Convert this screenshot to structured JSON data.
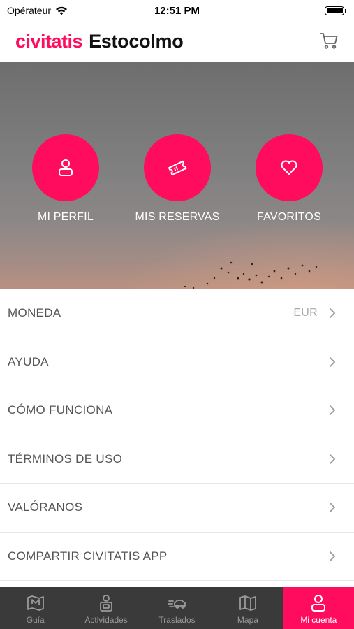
{
  "status": {
    "carrier": "Opérateur",
    "time": "12:51 PM"
  },
  "header": {
    "brand": "civitatis",
    "city": "Estocolmo"
  },
  "hero": {
    "buttons": [
      {
        "label": "MI PERFIL",
        "icon": "user-icon"
      },
      {
        "label": "MIS RESERVAS",
        "icon": "ticket-icon"
      },
      {
        "label": "FAVORITOS",
        "icon": "heart-icon"
      }
    ]
  },
  "menu": {
    "items": [
      {
        "label": "MONEDA",
        "value": "EUR"
      },
      {
        "label": "AYUDA"
      },
      {
        "label": "CÓMO FUNCIONA"
      },
      {
        "label": "TÉRMINOS DE USO"
      },
      {
        "label": "VALÓRANOS"
      },
      {
        "label": "COMPARTIR CIVITATIS APP"
      }
    ]
  },
  "tabbar": {
    "tabs": [
      {
        "label": "Guía",
        "icon": "guide-map-icon"
      },
      {
        "label": "Actividades",
        "icon": "activities-icon"
      },
      {
        "label": "Traslados",
        "icon": "transfer-car-icon"
      },
      {
        "label": "Mapa",
        "icon": "map-icon"
      },
      {
        "label": "Mi cuenta",
        "icon": "account-icon",
        "active": true
      }
    ]
  },
  "colors": {
    "accent": "#ff0c5f",
    "tabbar_bg": "#3a3a3a"
  }
}
